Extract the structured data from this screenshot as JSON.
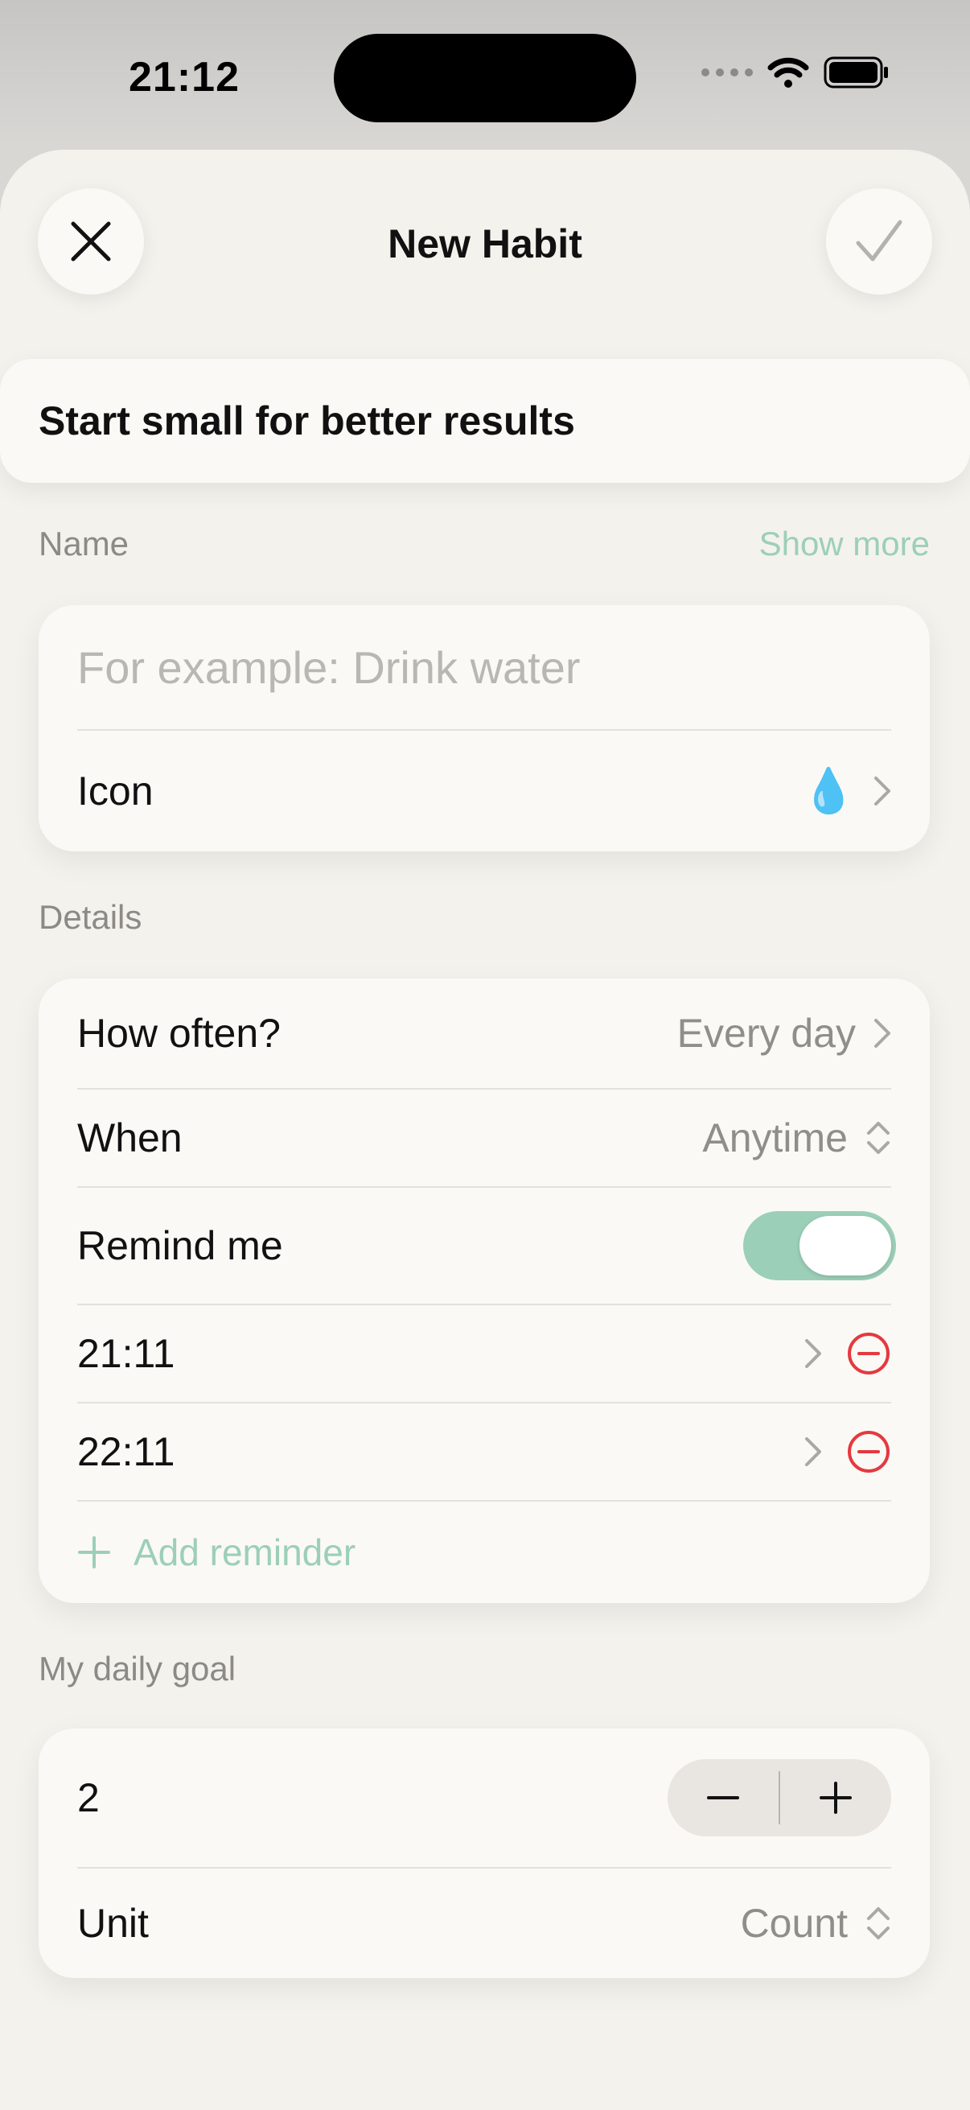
{
  "status_bar": {
    "time": "21:12"
  },
  "header": {
    "title": "New Habit"
  },
  "tip": {
    "text": "Start small for better results"
  },
  "name_section": {
    "label": "Name",
    "show_more": "Show more",
    "name_placeholder": "For example: Drink water",
    "icon_label": "Icon",
    "icon_value": "💧"
  },
  "details_section": {
    "label": "Details",
    "how_often_label": "How often?",
    "how_often_value": "Every day",
    "when_label": "When",
    "when_value": "Anytime",
    "remind_label": "Remind me",
    "remind_on": true,
    "reminders": [
      "21:11",
      "22:11"
    ],
    "add_reminder": "Add reminder"
  },
  "goal_section": {
    "label": "My daily goal",
    "goal_value": "2",
    "unit_label": "Unit",
    "unit_value": "Count"
  },
  "colors": {
    "accent": "#9ccfb8",
    "danger": "#e5393f",
    "sheet": "#f4f2ed",
    "card": "#fbf9f5"
  }
}
